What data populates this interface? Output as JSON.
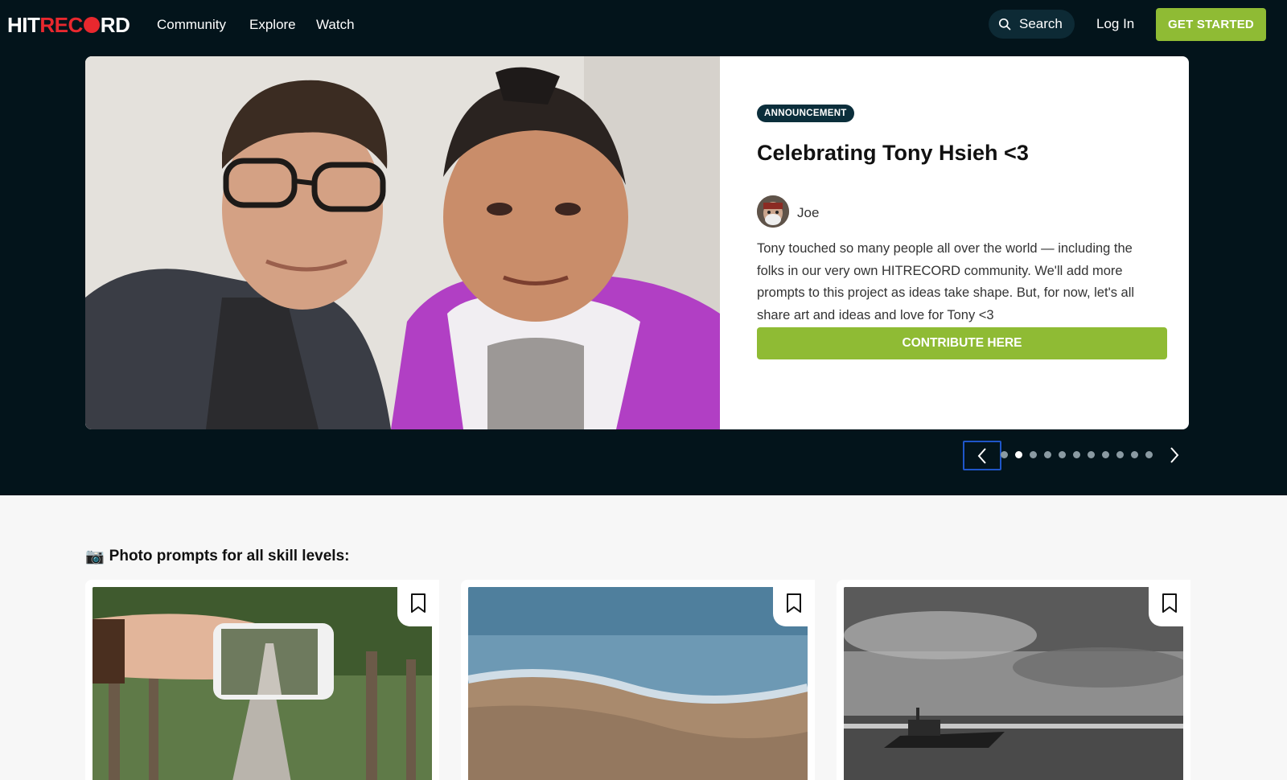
{
  "nav": {
    "logo": {
      "part1": "HIT",
      "part2": "REC",
      "part3": "RD"
    },
    "links": [
      "Community",
      "Explore",
      "Watch"
    ],
    "search_label": "Search",
    "login_label": "Log In",
    "get_started_label": "GET STARTED"
  },
  "hero": {
    "badge": "ANNOUNCEMENT",
    "title": "Celebrating Tony Hsieh <3",
    "author": "Joe",
    "description": "Tony touched so many people all over the world — including the folks in our very own HITRECORD community. We'll add more prompts to this project as ideas take shape. But, for now, let's all share art and ideas and love for Tony <3",
    "cta_label": "CONTRIBUTE HERE"
  },
  "carousel": {
    "slide_count": 11,
    "active_index": 1
  },
  "section": {
    "icon": "📷",
    "title": "Photo prompts for all skill levels:"
  },
  "cards": [
    {
      "image": "hand-holding-phone-photo",
      "bookmark": "bookmark-icon"
    },
    {
      "image": "beach-waves-photo",
      "bookmark": "bookmark-icon"
    },
    {
      "image": "black-white-boat-photo",
      "bookmark": "bookmark-icon"
    }
  ],
  "colors": {
    "dark_bg": "#03141b",
    "accent_green": "#8fbb34",
    "brand_red": "#e8282e",
    "badge_bg": "#0b2e3b"
  }
}
